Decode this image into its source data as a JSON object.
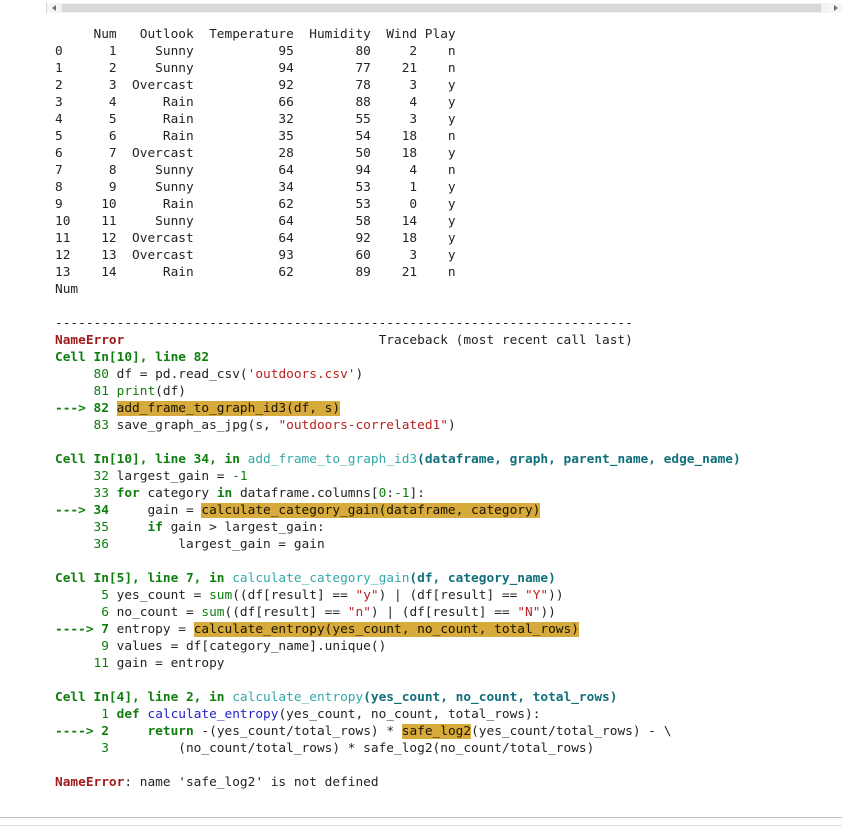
{
  "colors": {
    "text": "#232323",
    "green": "#0e7e0e",
    "str": "#ba2121",
    "cyan": "#33a8a8",
    "cyand": "#0f6f7a",
    "blue": "#2222cc",
    "error": "#a01c1c",
    "hl": "#d7ab3b"
  },
  "scrollbar": {
    "left_icon": "triangle-left-icon",
    "right_icon": "triangle-right-icon"
  },
  "dataframe": {
    "columns": [
      "Num",
      "Outlook",
      "Temperature",
      "Humidity",
      "Wind",
      "Play"
    ],
    "rows": [
      [
        0,
        1,
        "Sunny",
        95,
        80,
        2,
        "n"
      ],
      [
        1,
        2,
        "Sunny",
        94,
        77,
        21,
        "n"
      ],
      [
        2,
        3,
        "Overcast",
        92,
        78,
        3,
        "y"
      ],
      [
        3,
        4,
        "Rain",
        66,
        88,
        4,
        "y"
      ],
      [
        4,
        5,
        "Rain",
        32,
        55,
        3,
        "y"
      ],
      [
        5,
        6,
        "Rain",
        35,
        54,
        18,
        "n"
      ],
      [
        6,
        7,
        "Overcast",
        28,
        50,
        18,
        "y"
      ],
      [
        7,
        8,
        "Sunny",
        64,
        94,
        4,
        "n"
      ],
      [
        8,
        9,
        "Sunny",
        34,
        53,
        1,
        "y"
      ],
      [
        9,
        10,
        "Rain",
        62,
        53,
        0,
        "y"
      ],
      [
        10,
        11,
        "Sunny",
        64,
        58,
        14,
        "y"
      ],
      [
        11,
        12,
        "Overcast",
        64,
        92,
        18,
        "y"
      ],
      [
        12,
        13,
        "Overcast",
        93,
        60,
        3,
        "y"
      ],
      [
        13,
        14,
        "Rain",
        62,
        89,
        21,
        "n"
      ]
    ],
    "lines": [
      "     Num   Outlook  Temperature  Humidity  Wind Play",
      "0      1     Sunny           95        80     2    n",
      "1      2     Sunny           94        77    21    n",
      "2      3  Overcast           92        78     3    y",
      "3      4      Rain           66        88     4    y",
      "4      5      Rain           32        55     3    y",
      "5      6      Rain           35        54    18    n",
      "6      7  Overcast           28        50    18    y",
      "7      8     Sunny           64        94     4    n",
      "8      9     Sunny           34        53     1    y",
      "9     10      Rain           62        53     0    y",
      "10    11     Sunny           64        58    14    y",
      "11    12  Overcast           64        92    18    y",
      "12    13  Overcast           93        60     3    y",
      "13    14      Rain           62        89    21    n",
      "Num",
      ""
    ]
  },
  "traceback": {
    "error_type": "NameError",
    "error_message": "name 'safe_log2' is not defined",
    "lines": [
      {
        "name": "traceback-separator",
        "segs": [
          [
            "plain",
            "---------------------------------------------------------------------------"
          ]
        ]
      },
      {
        "name": "traceback-header",
        "segs": [
          [
            "errname",
            "NameError"
          ],
          [
            "plain",
            "                                 Traceback (most recent call last)"
          ]
        ]
      },
      {
        "name": "frame-header",
        "segs": [
          [
            "frame",
            "Cell In[10], line 82"
          ]
        ]
      },
      {
        "name": "code-line",
        "segs": [
          [
            "ln",
            "     80 "
          ],
          [
            "plain",
            "df = pd.read_csv("
          ],
          [
            "str",
            "'outdoors.csv'"
          ],
          [
            "plain",
            ")"
          ]
        ]
      },
      {
        "name": "code-line",
        "segs": [
          [
            "ln",
            "     81 "
          ],
          [
            "builtin",
            "print"
          ],
          [
            "plain",
            "(df)"
          ]
        ]
      },
      {
        "name": "error-line",
        "segs": [
          [
            "arrow",
            "---> 82 "
          ],
          [
            "hl",
            "add_frame_to_graph_id3(df, s)"
          ]
        ]
      },
      {
        "name": "code-line",
        "segs": [
          [
            "ln",
            "     83 "
          ],
          [
            "plain",
            "save_graph_as_jpg(s, "
          ],
          [
            "str",
            "\"outdoors-correlated1\""
          ],
          [
            "plain",
            ")"
          ]
        ]
      },
      {
        "name": "blank-line",
        "segs": []
      },
      {
        "name": "frame-header",
        "segs": [
          [
            "frame",
            "Cell In[10], line 34, in "
          ],
          [
            "cy",
            "add_frame_to_graph_id3"
          ],
          [
            "cyb",
            "(dataframe, graph, parent_name, edge_name)"
          ]
        ]
      },
      {
        "name": "code-line",
        "segs": [
          [
            "ln",
            "     32 "
          ],
          [
            "plain",
            "largest_gain = "
          ],
          [
            "num",
            "-1"
          ]
        ]
      },
      {
        "name": "code-line",
        "segs": [
          [
            "ln",
            "     33 "
          ],
          [
            "kw",
            "for"
          ],
          [
            "plain",
            " category "
          ],
          [
            "kw",
            "in"
          ],
          [
            "plain",
            " dataframe.columns["
          ],
          [
            "num",
            "0"
          ],
          [
            "plain",
            ":"
          ],
          [
            "num",
            "-1"
          ],
          [
            "plain",
            "]:"
          ]
        ]
      },
      {
        "name": "error-line",
        "segs": [
          [
            "arrow",
            "---> 34 "
          ],
          [
            "plain",
            "    gain = "
          ],
          [
            "hl",
            "calculate_category_gain(dataframe, category)"
          ]
        ]
      },
      {
        "name": "code-line",
        "segs": [
          [
            "ln",
            "     35 "
          ],
          [
            "plain",
            "    "
          ],
          [
            "kw",
            "if"
          ],
          [
            "plain",
            " gain > largest_gain:"
          ]
        ]
      },
      {
        "name": "code-line",
        "segs": [
          [
            "ln",
            "     36 "
          ],
          [
            "plain",
            "        largest_gain = gain"
          ]
        ]
      },
      {
        "name": "blank-line",
        "segs": []
      },
      {
        "name": "frame-header",
        "segs": [
          [
            "frame",
            "Cell In[5], line 7, in "
          ],
          [
            "cy",
            "calculate_category_gain"
          ],
          [
            "cyb",
            "(df, category_name)"
          ]
        ]
      },
      {
        "name": "code-line",
        "segs": [
          [
            "ln",
            "      5 "
          ],
          [
            "plain",
            "yes_count = "
          ],
          [
            "builtin",
            "sum"
          ],
          [
            "plain",
            "((df[result] == "
          ],
          [
            "str",
            "\"y\""
          ],
          [
            "plain",
            ") | (df[result] == "
          ],
          [
            "str",
            "\"Y\""
          ],
          [
            "plain",
            "))"
          ]
        ]
      },
      {
        "name": "code-line",
        "segs": [
          [
            "ln",
            "      6 "
          ],
          [
            "plain",
            "no_count = "
          ],
          [
            "builtin",
            "sum"
          ],
          [
            "plain",
            "((df[result] == "
          ],
          [
            "str",
            "\"n\""
          ],
          [
            "plain",
            ") | (df[result] == "
          ],
          [
            "str",
            "\"N\""
          ],
          [
            "plain",
            "))"
          ]
        ]
      },
      {
        "name": "error-line",
        "segs": [
          [
            "arrow",
            "----> 7 "
          ],
          [
            "plain",
            "entropy = "
          ],
          [
            "hl",
            "calculate_entropy(yes_count, no_count, total_rows)"
          ]
        ]
      },
      {
        "name": "code-line",
        "segs": [
          [
            "ln",
            "      9 "
          ],
          [
            "plain",
            "values = df[category_name].unique()"
          ]
        ]
      },
      {
        "name": "code-line",
        "segs": [
          [
            "ln",
            "     11 "
          ],
          [
            "plain",
            "gain = entropy"
          ]
        ]
      },
      {
        "name": "blank-line",
        "segs": []
      },
      {
        "name": "frame-header",
        "segs": [
          [
            "frame",
            "Cell In[4], line 2, in "
          ],
          [
            "cy",
            "calculate_entropy"
          ],
          [
            "cyb",
            "(yes_count, no_count, total_rows)"
          ]
        ]
      },
      {
        "name": "code-line",
        "segs": [
          [
            "ln",
            "      1 "
          ],
          [
            "kw",
            "def"
          ],
          [
            "plain",
            " "
          ],
          [
            "fn",
            "calculate_entropy"
          ],
          [
            "plain",
            "(yes_count, no_count, total_rows):"
          ]
        ]
      },
      {
        "name": "error-line",
        "segs": [
          [
            "arrow",
            "----> 2 "
          ],
          [
            "plain",
            "    "
          ],
          [
            "kw",
            "return"
          ],
          [
            "plain",
            " -(yes_count/total_rows) * "
          ],
          [
            "hl",
            "safe_log2"
          ],
          [
            "plain",
            "(yes_count/total_rows) - \\"
          ]
        ]
      },
      {
        "name": "code-line",
        "segs": [
          [
            "ln",
            "      3 "
          ],
          [
            "plain",
            "        (no_count/total_rows) * safe_log2(no_count/total_rows)"
          ]
        ]
      },
      {
        "name": "blank-line",
        "segs": []
      },
      {
        "name": "error-message",
        "segs": [
          [
            "errname",
            "NameError"
          ],
          [
            "plain",
            ": name 'safe_log2' is not defined"
          ]
        ]
      }
    ]
  }
}
